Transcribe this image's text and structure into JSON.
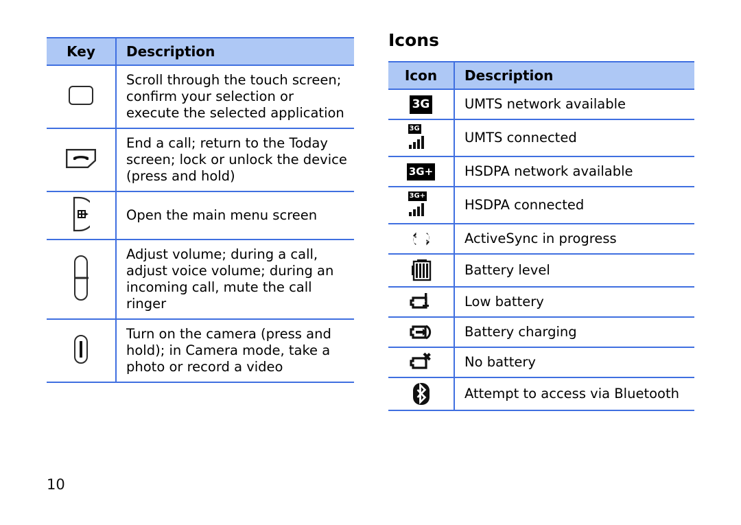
{
  "theme": {
    "header_bg": "#aec8f5",
    "rule_color": "#3f6fe0",
    "text_color": "#000000",
    "icon_color": "#111111"
  },
  "page": {
    "number": "10"
  },
  "key_table": {
    "headers": {
      "key": "Key",
      "description": "Description"
    },
    "rows": [
      {
        "icon_name": "confirm-key-icon",
        "description": "Scroll through the touch screen; confirm your selection or execute the selected application"
      },
      {
        "icon_name": "end-call-key-icon",
        "description": "End a call; return to the Today screen; lock or unlock the device (press and hold)"
      },
      {
        "icon_name": "main-menu-key-icon",
        "description": "Open the main menu screen"
      },
      {
        "icon_name": "volume-key-icon",
        "description": "Adjust volume; during a call, adjust voice volume; during an incoming call, mute the call ringer"
      },
      {
        "icon_name": "camera-key-icon",
        "description": "Turn on the camera (press and hold); in Camera mode, take a photo or record a video"
      }
    ]
  },
  "icons_section": {
    "title": "Icons",
    "headers": {
      "icon": "Icon",
      "description": "Description"
    },
    "rows": [
      {
        "icon_name": "umts-available-icon",
        "glyph_label": "3G",
        "description": "UMTS network available"
      },
      {
        "icon_name": "umts-connected-icon",
        "glyph_label": "3G",
        "description": "UMTS connected"
      },
      {
        "icon_name": "hsdpa-available-icon",
        "glyph_label": "3G+",
        "description": "HSDPA network available"
      },
      {
        "icon_name": "hsdpa-connected-icon",
        "glyph_label": "3G+",
        "description": "HSDPA connected"
      },
      {
        "icon_name": "activesync-icon",
        "glyph_label": "",
        "description": "ActiveSync in progress"
      },
      {
        "icon_name": "battery-level-icon",
        "glyph_label": "",
        "description": "Battery level"
      },
      {
        "icon_name": "low-battery-icon",
        "glyph_label": "",
        "description": "Low battery"
      },
      {
        "icon_name": "battery-charging-icon",
        "glyph_label": "",
        "description": "Battery charging"
      },
      {
        "icon_name": "no-battery-icon",
        "glyph_label": "",
        "description": "No battery"
      },
      {
        "icon_name": "bluetooth-icon",
        "glyph_label": "",
        "description": "Attempt to access via Bluetooth"
      }
    ]
  }
}
